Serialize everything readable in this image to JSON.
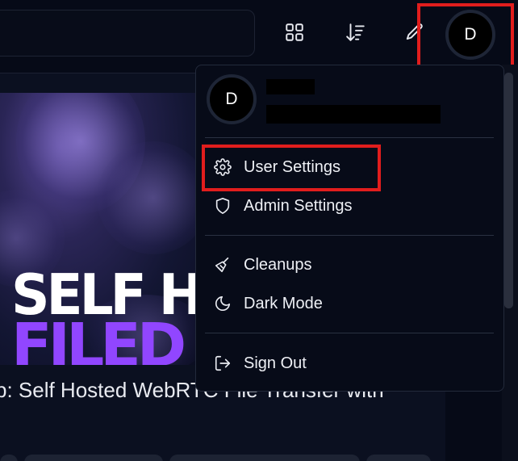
{
  "header": {
    "avatar_initial": "D",
    "icons": [
      "grid-icon",
      "sort-descending-icon",
      "pencil-icon"
    ]
  },
  "content": {
    "thumbnail": {
      "line1": "SELF HO",
      "line2": "FILED"
    },
    "video_title": "p: Self Hosted WebRTC File Transfer with"
  },
  "menu": {
    "avatar_initial": "D",
    "items": [
      {
        "label": "User Settings",
        "icon": "gear-icon"
      },
      {
        "label": "Admin Settings",
        "icon": "shield-icon"
      },
      {
        "label": "Cleanups",
        "icon": "broom-icon"
      },
      {
        "label": "Dark Mode",
        "icon": "moon-icon"
      },
      {
        "label": "Sign Out",
        "icon": "sign-out-icon"
      }
    ]
  },
  "colors": {
    "background": "#060a17",
    "menu_bg": "#070b18",
    "highlight": "#e11d1d",
    "accent_purple": "#9146ff"
  }
}
